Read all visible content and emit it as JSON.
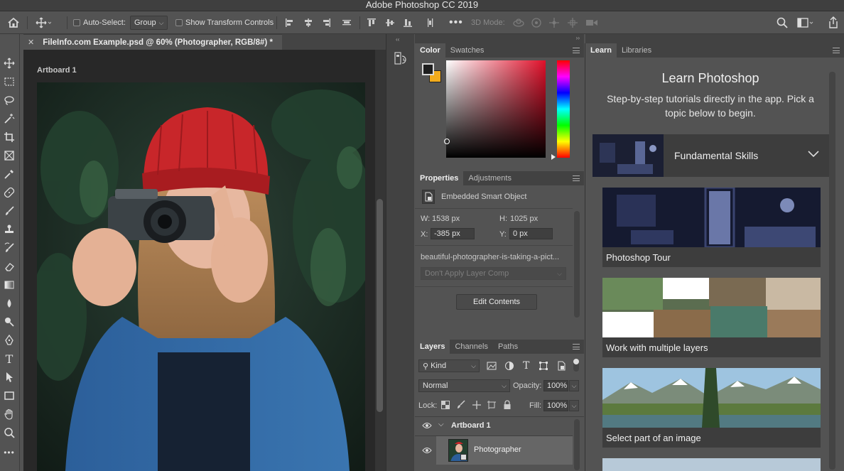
{
  "window": {
    "title": "Adobe Photoshop CC 2019"
  },
  "options_bar": {
    "auto_select_label": "Auto-Select:",
    "auto_select_value": "Group",
    "show_transform_label": "Show Transform Controls",
    "mode_3d_label": "3D Mode:"
  },
  "document": {
    "tab_title": "FileInfo.com Example.psd @ 60% (Photographer, RGB/8#) *",
    "artboard_label": "Artboard 1"
  },
  "color_panel": {
    "tabs": [
      "Color",
      "Swatches"
    ],
    "foreground": "#1e1e1e",
    "background": "#f2ab1c"
  },
  "properties_panel": {
    "tabs": [
      "Properties",
      "Adjustments"
    ],
    "type_label": "Embedded Smart Object",
    "w_label": "W:",
    "w_value": "1538 px",
    "h_label": "H:",
    "h_value": "1025 px",
    "x_label": "X:",
    "x_value": "-385 px",
    "y_label": "Y:",
    "y_value": "0 px",
    "filename": "beautiful-photographer-is-taking-a-pict...",
    "layer_comp": "Don't Apply Layer Comp",
    "edit_button": "Edit Contents"
  },
  "layers_panel": {
    "tabs": [
      "Layers",
      "Channels",
      "Paths"
    ],
    "filter_kind": "Kind",
    "blend_mode": "Normal",
    "opacity_label": "Opacity:",
    "opacity_value": "100%",
    "lock_label": "Lock:",
    "fill_label": "Fill:",
    "fill_value": "100%",
    "layers": [
      {
        "name": "Artboard 1"
      },
      {
        "name": "Photographer"
      }
    ]
  },
  "learn_panel": {
    "tabs": [
      "Learn",
      "Libraries"
    ],
    "title": "Learn Photoshop",
    "subtitle_line1": "Step-by-step tutorials directly in the app. Pick a",
    "subtitle_line2": "topic below to begin.",
    "category": "Fundamental Skills",
    "tutorials": [
      {
        "label": "Photoshop Tour"
      },
      {
        "label": "Work with multiple layers"
      },
      {
        "label": "Select part of an image"
      }
    ]
  },
  "colors": {
    "hat_red": "#c8262a",
    "accent_orange": "#f2ab1c"
  }
}
